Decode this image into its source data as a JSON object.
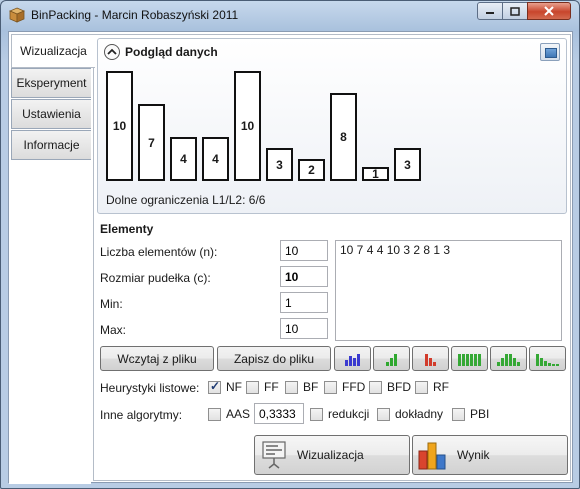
{
  "window": {
    "title": "BinPacking - Marcin Robaszyński 2011",
    "app_icon": "package-box-icon",
    "controls": [
      "minimize-icon",
      "maximize-icon",
      "close-icon"
    ]
  },
  "tabs": [
    {
      "label": "Wizualizacja",
      "active": true
    },
    {
      "label": "Eksperyment",
      "active": false
    },
    {
      "label": "Ustawienia",
      "active": false
    },
    {
      "label": "Informacje",
      "active": false
    }
  ],
  "preview": {
    "title": "Podgląd danych",
    "collapse_icon": "chevron-up-icon",
    "export_icon": "image-icon",
    "bin_capacity": 10,
    "items": [
      10,
      7,
      4,
      4,
      10,
      3,
      2,
      8,
      1,
      3
    ],
    "lower_bounds": "Dolne ograniczenia L1/L2: 6/6"
  },
  "elements": {
    "title": "Elementy",
    "count_label": "Liczba elementów (n):",
    "count_value": "10",
    "capacity_label": "Rozmiar pudełka (c):",
    "capacity_value": "10",
    "min_label": "Min:",
    "min_value": "1",
    "max_label": "Max:",
    "max_value": "10",
    "list_text": "10 7 4 4 10 3 2 8 1 3"
  },
  "actions": {
    "load_label": "Wczytaj z pliku",
    "save_label": "Zapisz do pliku",
    "chart_buttons": [
      {
        "name": "blue-bars-icon",
        "color": "#3a3ad0",
        "heights": [
          6,
          10,
          8,
          12
        ]
      },
      {
        "name": "green-bars-icon",
        "color": "#2fa82f",
        "heights": [
          4,
          8,
          12
        ]
      },
      {
        "name": "red-bars-icon",
        "color": "#d23b2b",
        "heights": [
          12,
          8,
          4
        ]
      },
      {
        "name": "green-even-bars-icon",
        "color": "#35a835",
        "heights": [
          12,
          12,
          12,
          12,
          12,
          12
        ]
      },
      {
        "name": "green-bell-bars-icon",
        "color": "#35a835",
        "heights": [
          4,
          8,
          12,
          12,
          8,
          4
        ]
      },
      {
        "name": "green-desc-bars-icon",
        "color": "#35a835",
        "heights": [
          12,
          8,
          5,
          3,
          2,
          2
        ]
      }
    ]
  },
  "heuristics": {
    "label": "Heurystyki listowe:",
    "options": [
      {
        "label": "NF",
        "checked": true
      },
      {
        "label": "FF",
        "checked": false
      },
      {
        "label": "BF",
        "checked": false
      },
      {
        "label": "FFD",
        "checked": false
      },
      {
        "label": "BFD",
        "checked": false
      },
      {
        "label": "RF",
        "checked": false
      }
    ]
  },
  "other_algorithms": {
    "label": "Inne algorytmy:",
    "aas_label": "AAS",
    "aas_value": "0,3333",
    "reduction_label": "redukcji",
    "exact_label": "dokładny",
    "pbi_label": "PBI"
  },
  "bottom": {
    "visualize_label": "Wizualizacja",
    "visualize_icon": "presentation-icon",
    "result_label": "Wynik",
    "result_icon": "bar-chart-icon"
  }
}
